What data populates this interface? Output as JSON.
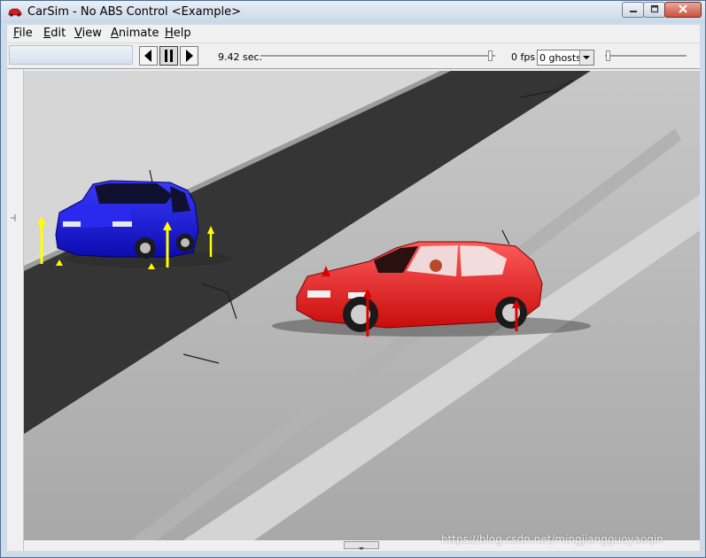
{
  "window": {
    "title": "CarSim - No ABS Control <Example>",
    "controls": {
      "minimize_icon": "minimize-icon",
      "maximize_icon": "maximize-icon",
      "close_icon": "close-icon"
    }
  },
  "menu": {
    "items": [
      {
        "label_u": "F",
        "label_rest": "ile"
      },
      {
        "label_u": "E",
        "label_rest": "dit"
      },
      {
        "label_u": "V",
        "label_rest": "iew"
      },
      {
        "label_u": "A",
        "label_rest": "nimate"
      },
      {
        "label_u": "H",
        "label_rest": "elp"
      }
    ]
  },
  "toolbar": {
    "time": "9.42 sec.",
    "time_slider_fraction": 0.98,
    "fps": "0 fps",
    "ghosts_selected": "0 ghosts",
    "ghost_slider_fraction": 0.0,
    "buttons": [
      "step-back-icon",
      "pause-icon",
      "play-icon"
    ]
  },
  "scene": {
    "vehicles": [
      {
        "name": "blue-car",
        "color": "#1414e6"
      },
      {
        "name": "red-car",
        "color": "#e81818"
      }
    ],
    "force_arrow_colors": {
      "blue-car": "#ffff00",
      "red-car": "#e00000"
    }
  },
  "watermark": "https://blog.csdn.net/mingjiangguoyaoqin"
}
